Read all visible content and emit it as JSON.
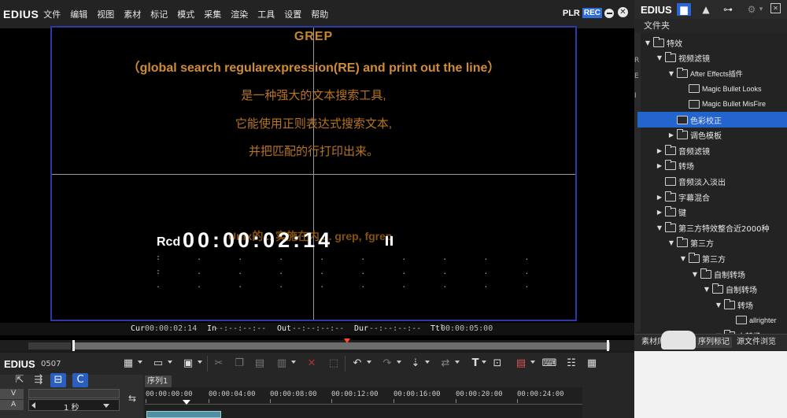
{
  "app": {
    "name": "EDIUS",
    "version": "0507"
  },
  "menu": [
    "文件",
    "编辑",
    "视图",
    "素材",
    "标记",
    "模式",
    "采集",
    "渲染",
    "工具",
    "设置",
    "帮助"
  ],
  "monitor": {
    "plr": "PLR",
    "rec": "REC"
  },
  "overlay": {
    "title": "GREP",
    "line1": "（global search regularexpression(RE) and print out the line）",
    "line2": "是一种强大的文本搜索工具,",
    "line3": "它能使用正则表达式搜索文本,",
    "line4": "并把匹配的行打印出来。",
    "ghost": "Unix的... 实施在内 ... grep, fgrep"
  },
  "timecode": {
    "rcd_label": "Rcd",
    "value": "00:00:02:14"
  },
  "timecodes": {
    "cur_label": "Cur",
    "cur_value": "00:00:02:14",
    "in_label": "In",
    "in_value": "--:--:--:--",
    "out_label": "Out",
    "out_value": "--:--:--:--",
    "dur_label": "Dur",
    "dur_value": "--:--:--:--",
    "ttl_label": "Ttl",
    "ttl_value": "00:00:05:00"
  },
  "timeline": {
    "sequence_tab": "序列1",
    "ruler": [
      "00:00:00:00",
      "00:00:04:00",
      "00:00:08:00",
      "00:00:12:00",
      "00:00:16:00",
      "00:00:20:00",
      "00:00:24:00"
    ],
    "track_v": "V",
    "track_a": "A",
    "step": "1 秒"
  },
  "right_panel": {
    "title": "EDIUS",
    "folder_label": "文件夹",
    "tree": [
      {
        "label": "特效",
        "level": 0,
        "toggle": "▼",
        "selected": false
      },
      {
        "label": "视频滤镜",
        "level": 1,
        "toggle": "▼",
        "selected": false
      },
      {
        "label": "After Effects插件",
        "level": 2,
        "toggle": "▼",
        "selected": false
      },
      {
        "label": "Magic Bullet Looks",
        "level": 3,
        "toggle": "",
        "selected": false
      },
      {
        "label": "Magic Bullet MisFire",
        "level": 3,
        "toggle": "",
        "selected": false
      },
      {
        "label": "色彩校正",
        "level": 2,
        "toggle": "",
        "selected": true
      },
      {
        "label": "调色模板",
        "level": 2,
        "toggle": "▶",
        "selected": false
      },
      {
        "label": "音频滤镜",
        "level": 1,
        "toggle": "▶",
        "selected": false
      },
      {
        "label": "转场",
        "level": 1,
        "toggle": "▶",
        "selected": false
      },
      {
        "label": "音频淡入淡出",
        "level": 1,
        "toggle": "",
        "selected": false
      },
      {
        "label": "字幕混合",
        "level": 1,
        "toggle": "▶",
        "selected": false
      },
      {
        "label": "键",
        "level": 1,
        "toggle": "▶",
        "selected": false
      },
      {
        "label": "第三方特效整合近2000种",
        "level": 1,
        "toggle": "▼",
        "selected": false
      },
      {
        "label": "第三方",
        "level": 2,
        "toggle": "▼",
        "selected": false
      },
      {
        "label": "第三方",
        "level": 3,
        "toggle": "▼",
        "selected": false
      },
      {
        "label": "自制转场",
        "level": 4,
        "toggle": "▼",
        "selected": false
      },
      {
        "label": "自制转场",
        "level": 5,
        "toggle": "▼",
        "selected": false
      },
      {
        "label": "转场",
        "level": 6,
        "toggle": "▼",
        "selected": false
      },
      {
        "label": "allrighter",
        "level": 7,
        "toggle": "",
        "selected": false
      },
      {
        "label": "小转场",
        "level": 6,
        "toggle": "▼",
        "selected": false
      }
    ],
    "bottom_tabs": [
      "素材库",
      "序列标记",
      "源文件浏览"
    ]
  }
}
